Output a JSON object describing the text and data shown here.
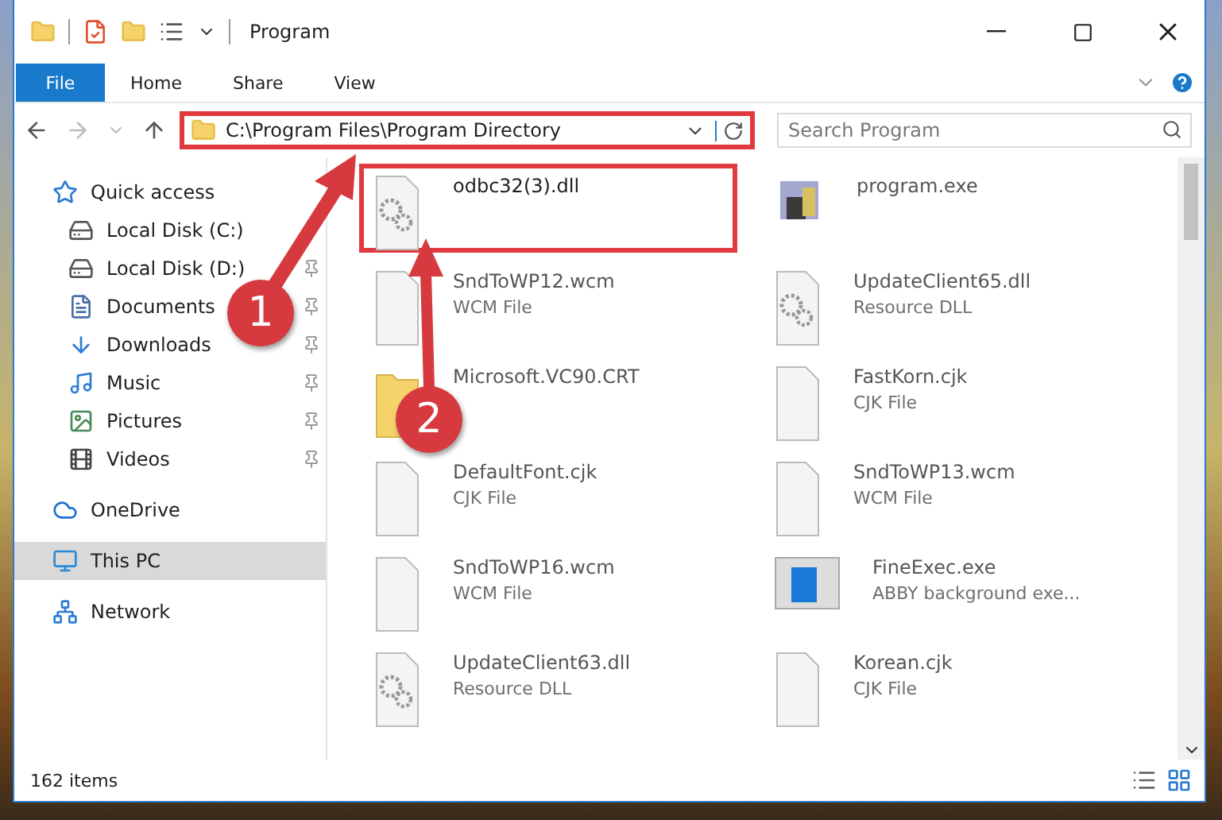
{
  "window": {
    "title": "Program"
  },
  "ribbon": {
    "tabs": [
      {
        "label": "File",
        "selected": true
      },
      {
        "label": "Home",
        "selected": false
      },
      {
        "label": "Share",
        "selected": false
      },
      {
        "label": "View",
        "selected": false
      }
    ]
  },
  "address": {
    "path": "C:\\Program Files\\Program Directory",
    "highlighted": true
  },
  "search": {
    "placeholder": "Search Program"
  },
  "sidebar": {
    "items": [
      {
        "label": "Quick access",
        "selected": false,
        "children": [
          {
            "label": "Local Disk (C:)",
            "pinned": false,
            "selected": false
          },
          {
            "label": "Local Disk (D:)",
            "pinned": true,
            "selected": false
          },
          {
            "label": "Documents",
            "pinned": true,
            "selected": false
          },
          {
            "label": "Downloads",
            "pinned": true,
            "selected": false
          },
          {
            "label": "Music",
            "pinned": true,
            "selected": false
          },
          {
            "label": "Pictures",
            "pinned": true,
            "selected": false
          },
          {
            "label": "Videos",
            "pinned": true,
            "selected": false
          }
        ]
      },
      {
        "label": "OneDrive",
        "selected": false
      },
      {
        "label": "This PC",
        "selected": true
      },
      {
        "label": "Network",
        "selected": false
      }
    ]
  },
  "files": [
    {
      "name": "odbc32(3).dll",
      "kind": "dll",
      "highlighted": true
    },
    {
      "name": "program.exe",
      "kind": "app",
      "highlighted": false
    },
    {
      "name": "SndToWP12.wcm",
      "type": "WCM File",
      "kind": "file",
      "highlighted": false
    },
    {
      "name": "UpdateClient65.dll",
      "type": "Resource DLL",
      "kind": "dll",
      "highlighted": false
    },
    {
      "name": "Microsoft.VC90.CRT",
      "kind": "folder",
      "highlighted": false
    },
    {
      "name": "FastKorn.cjk",
      "type": "CJK File",
      "kind": "file",
      "highlighted": false
    },
    {
      "name": "DefaultFont.cjk",
      "type": "CJK File",
      "kind": "file",
      "highlighted": false
    },
    {
      "name": "SndToWP13.wcm",
      "type": "WCM File",
      "kind": "file",
      "highlighted": false
    },
    {
      "name": "SndToWP16.wcm",
      "type": "WCM File",
      "kind": "file",
      "highlighted": false
    },
    {
      "name": "FineExec.exe",
      "type": "ABBY background exe...",
      "kind": "exe",
      "highlighted": false
    },
    {
      "name": "UpdateClient63.dll",
      "type": "Resource DLL",
      "kind": "dll",
      "highlighted": false
    },
    {
      "name": "Korean.cjk",
      "type": "CJK File",
      "kind": "file",
      "highlighted": false
    }
  ],
  "status_bar": {
    "count": "162 items"
  },
  "annotations": [
    {
      "label": "1"
    },
    {
      "label": "2"
    }
  ]
}
